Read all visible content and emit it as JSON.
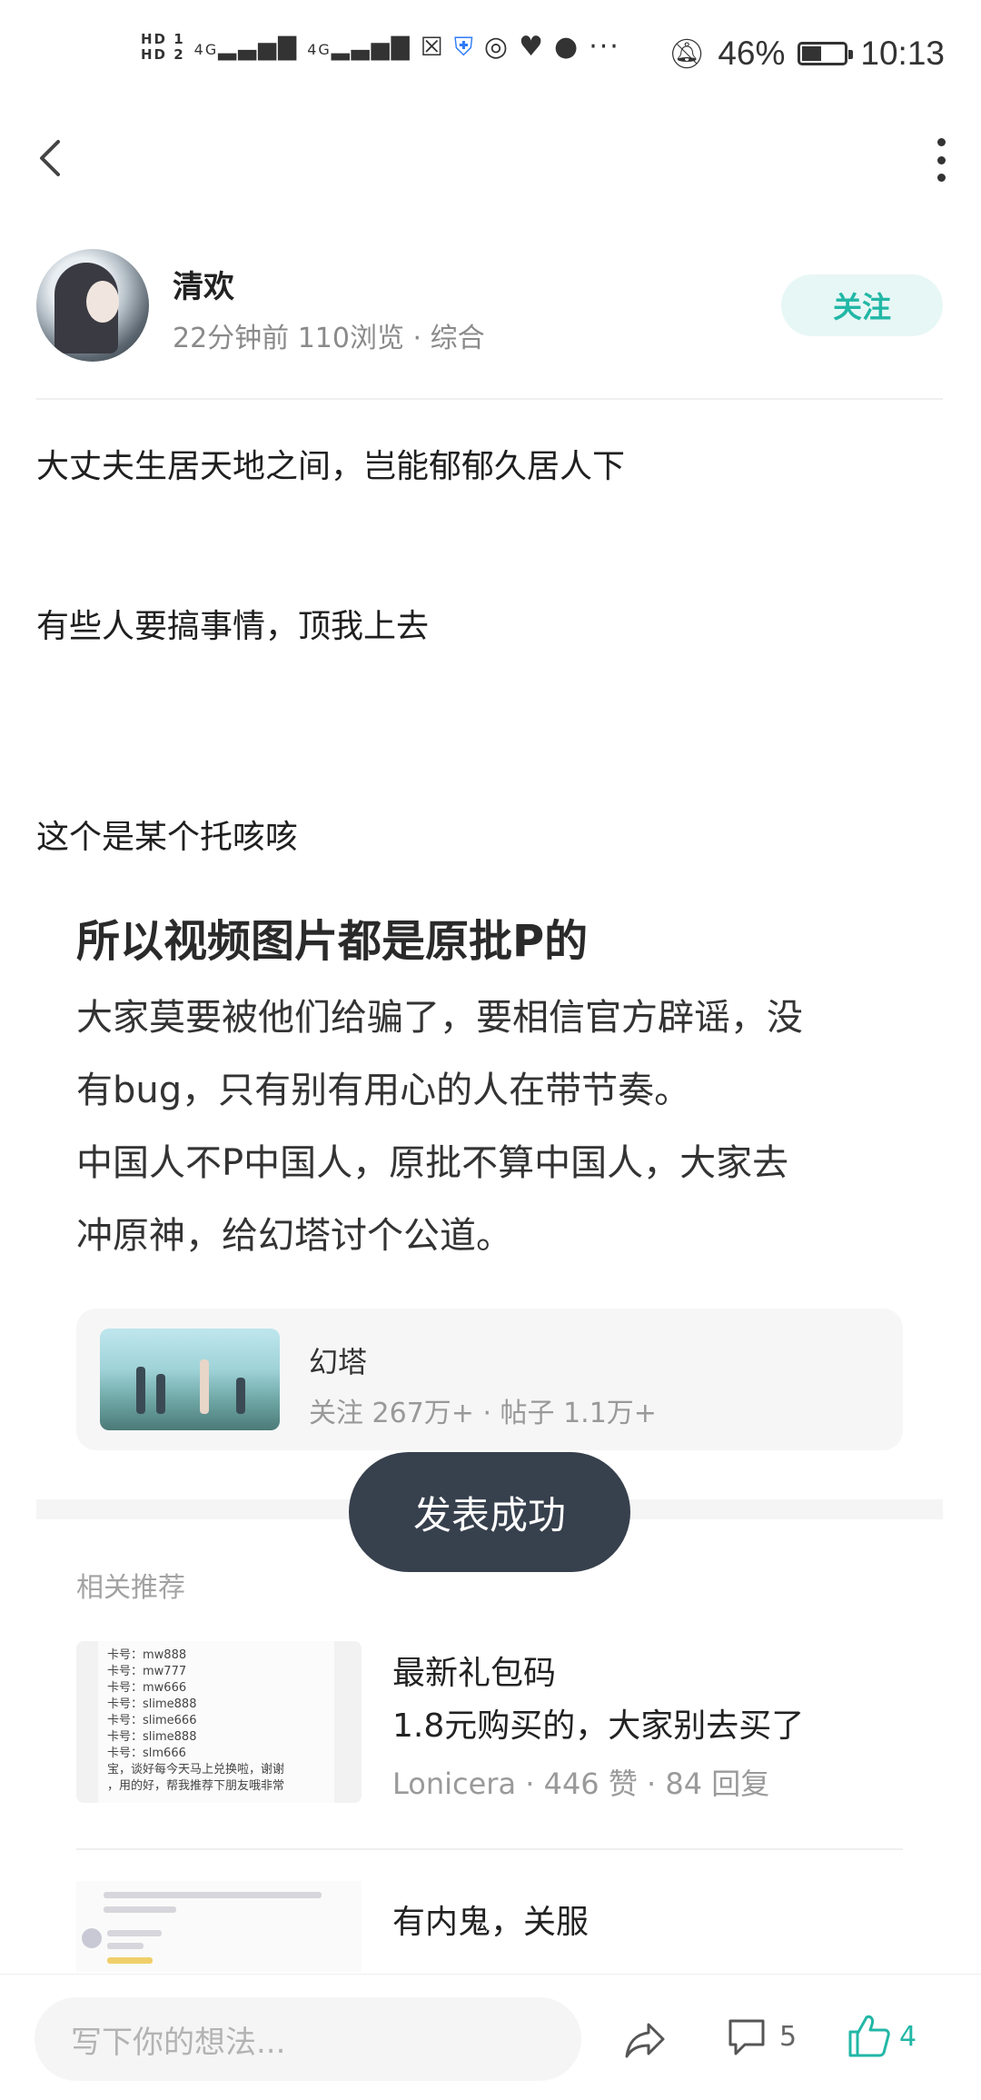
{
  "status_bar": {
    "hd1": "HD 1",
    "hd2": "HD 2",
    "net1": "4G",
    "net2": "4G",
    "extra": "···",
    "battery_pct": "46%",
    "battery_level": 0.46,
    "time": "10:13"
  },
  "nav": {
    "back_icon": "chevron-left-icon",
    "more_icon": "more-vertical-icon"
  },
  "author": {
    "name": "清欢",
    "meta": "22分钟前  110浏览 · 综合",
    "follow_label": "关注"
  },
  "post": {
    "line1": "大丈夫生居天地之间，岂能郁郁久居人下",
    "line2": "有些人要搞事情，顶我上去",
    "line3": "这个是某个托咳咳"
  },
  "embedded": {
    "title": "所以视频图片都是原批P的",
    "p1": "大家莫要被他们给骗了，要相信官方辟谣，没",
    "p2": "有bug，只有别有用心的人在带节奏。",
    "p3": " 中国人不P中国人，原批不算中国人，大家去",
    "p4": "冲原神，给幻塔讨个公道。"
  },
  "topic": {
    "name": "幻塔",
    "meta": "关注 267万+  ·  帖子 1.1万+"
  },
  "toast": "发表成功",
  "recommend": {
    "heading": "相关推荐",
    "items": [
      {
        "title": "最新礼包码",
        "subtitle": "1.8元购买的，大家别去买了",
        "meta": "Lonicera  ·  446 赞  ·  84 回复",
        "thumb_lines": [
          "卡号：mw888",
          "卡号：mw777",
          "卡号：mw666",
          "卡号：slime888",
          "卡号：slime666",
          "卡号：slime888",
          "卡号：slm666",
          "宝，谈好每今天马上兑换啦，谢谢",
          "，用的好，帮我推荐下朋友哦非常"
        ]
      },
      {
        "title": "有内鬼，关服"
      }
    ]
  },
  "bottom": {
    "input_placeholder": "写下你的想法...",
    "comment_count": "5",
    "like_count": "4"
  },
  "colors": {
    "accent": "#22b7a6",
    "follow_bg": "#e7f7f5",
    "toast_bg": "#37404d"
  }
}
